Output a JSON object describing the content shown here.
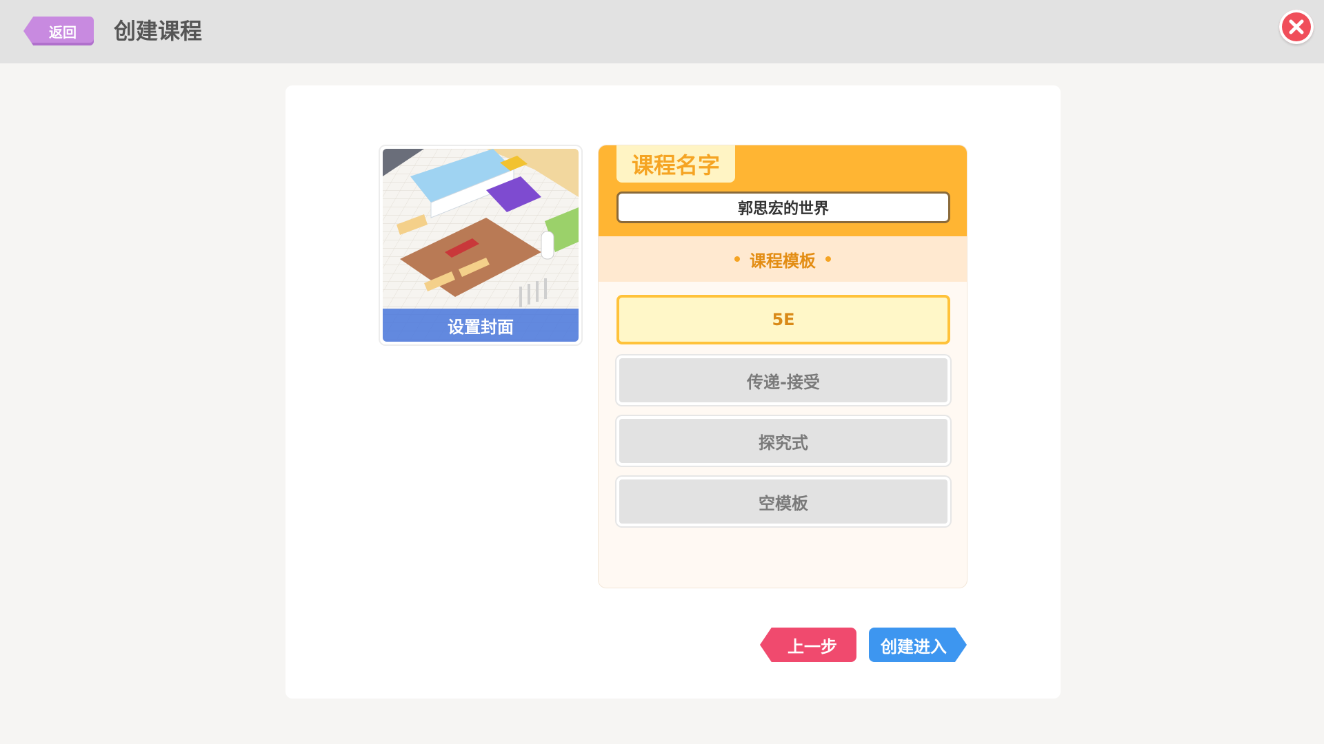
{
  "header": {
    "back_label": "返回",
    "title": "创建课程",
    "close_icon": "close-icon"
  },
  "cover": {
    "caption": "设置封面",
    "image": "isometric-construction-scene"
  },
  "course": {
    "name_tab": "课程名字",
    "name_value": "郭思宏的世界",
    "template_heading": "课程模板",
    "templates": [
      {
        "label": "5E",
        "selected": true
      },
      {
        "label": "传递-接受",
        "selected": false
      },
      {
        "label": "探究式",
        "selected": false
      },
      {
        "label": "空模板",
        "selected": false
      }
    ]
  },
  "footer": {
    "prev_label": "上一步",
    "next_label": "创建进入"
  },
  "colors": {
    "accent_orange": "#ffb533",
    "back_purple": "#c88ae0",
    "close_red": "#f04e5a",
    "prev_pink": "#f04a6e",
    "next_blue": "#3d96f0"
  }
}
